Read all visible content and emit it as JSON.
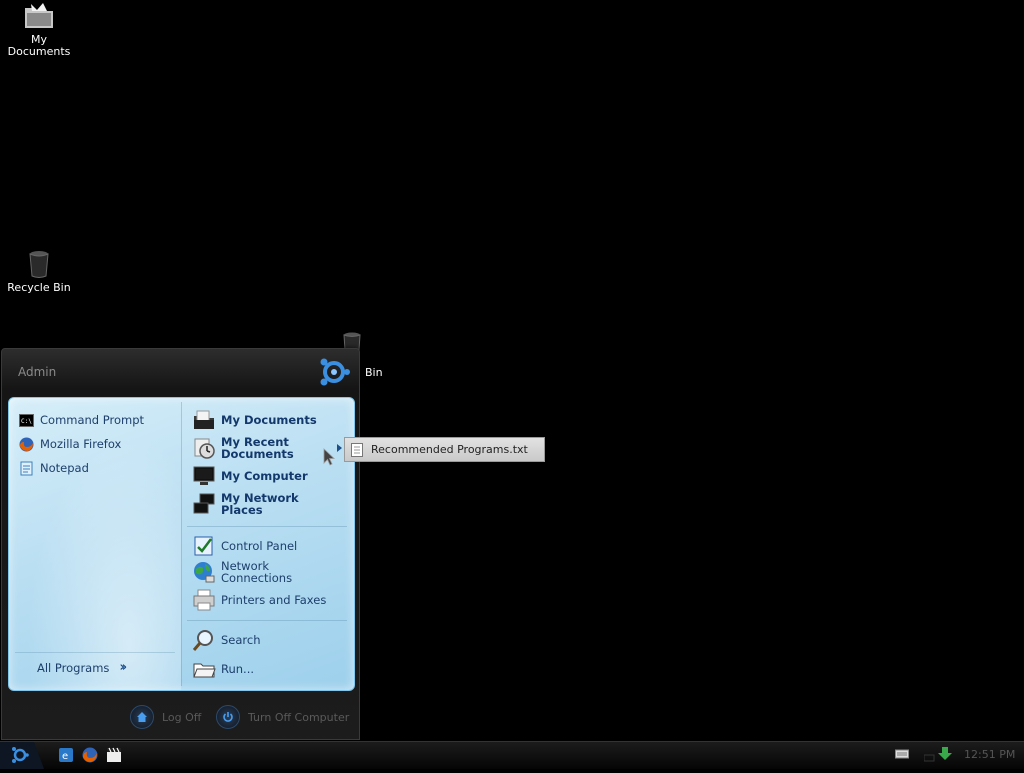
{
  "desktop": {
    "icons": [
      {
        "label_line1": "My",
        "label_line2": "Documents"
      },
      {
        "label": "Recycle Bin"
      },
      {
        "label_partial": "Bin"
      }
    ]
  },
  "start_menu": {
    "user_name": "Admin",
    "pinned": [
      {
        "label": "Command Prompt",
        "icon": "command-prompt-icon"
      },
      {
        "label": "Mozilla Firefox",
        "icon": "firefox-icon"
      },
      {
        "label": "Notepad",
        "icon": "notepad-icon"
      }
    ],
    "all_programs": "All Programs",
    "right": {
      "my_documents": "My Documents",
      "my_recent_line1": "My Recent",
      "my_recent_line2": "Documents",
      "my_computer": "My Computer",
      "my_network_line1": "My Network",
      "my_network_line2": "Places",
      "control_panel": "Control Panel",
      "network_line1": "Network",
      "network_line2": "Connections",
      "printers": "Printers and Faxes",
      "search": "Search",
      "run": "Run..."
    },
    "footer": {
      "log_off": "Log Off",
      "turn_off": "Turn Off Computer"
    }
  },
  "submenu": {
    "items": [
      {
        "label": "Recommended Programs.txt"
      }
    ]
  },
  "taskbar": {
    "clock": "12:51 PM"
  },
  "colors": {
    "accent": "#3a8fe0",
    "menu_text": "#1d3f6b"
  }
}
